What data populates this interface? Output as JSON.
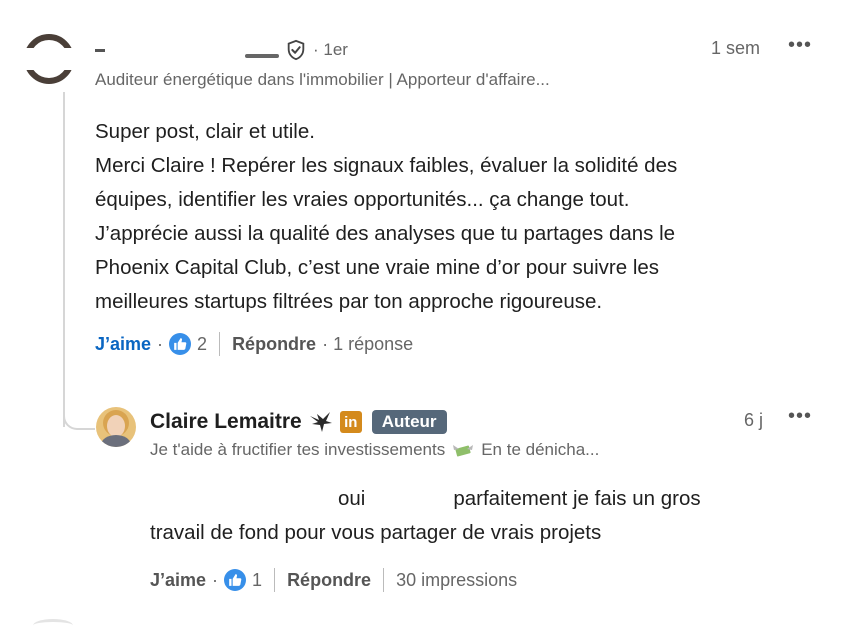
{
  "comment": {
    "degree": "1er",
    "time": "1 sem",
    "more": "•••",
    "headline": "Auditeur énergétique dans l'immobilier | Apporteur d'affaire...",
    "body": [
      "Super post, clair et utile.",
      "Merci Claire ! Repérer les signaux faibles, évaluer la solidité des",
      "équipes, identifier les vraies opportunités... ça change tout.",
      "J’apprécie aussi la qualité des analyses que tu partages dans le",
      "Phoenix Capital Club, c’est une vraie mine d’or pour suivre les",
      "meilleures startups filtrées par ton approche rigoureuse."
    ],
    "actions": {
      "like": "J’aime",
      "dot": "·",
      "like_count": "2",
      "reply": "Répondre",
      "reply_info": "· 1 réponse"
    }
  },
  "reply": {
    "author": "Claire Lemaitre",
    "li_badge": "in",
    "author_badge": "Auteur",
    "time": "6 j",
    "more": "•••",
    "headline_before": "Je t'aide à fructifier tes investissements",
    "headline_after": "En te dénicha...",
    "body_line1_a": "oui",
    "body_line1_b": "parfaitement je fais un gros",
    "body_line2": "travail de fond pour vous partager de vrais projets",
    "actions": {
      "like": "J’aime",
      "dot": "·",
      "like_count": "1",
      "reply": "Répondre",
      "impressions": "30 impressions"
    }
  },
  "colors": {
    "like_blue": "#0a66c2",
    "like_icon": "#378fe9",
    "author_badge": "#56687a",
    "li_badge": "#d48a1c"
  },
  "icons": [
    "shield-check-icon",
    "like-thumb-icon",
    "eagle-icon",
    "money-wings-icon",
    "more-icon"
  ]
}
